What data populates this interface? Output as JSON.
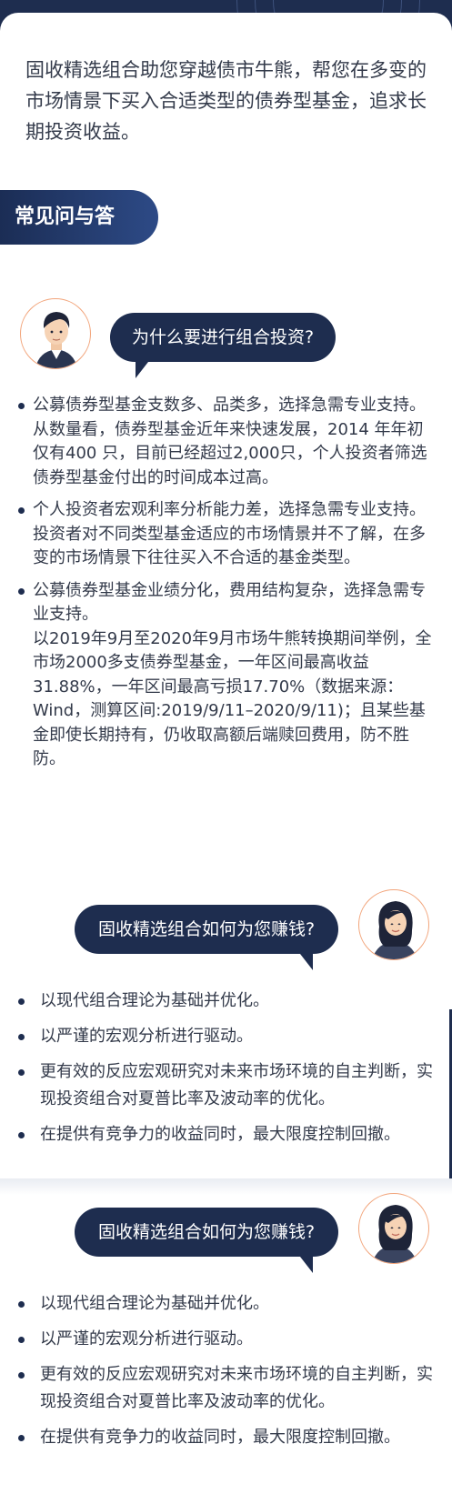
{
  "intro": {
    "text": "固收精选组合助您穿越债市牛熊，帮您在多变的市场情景下买入合适类型的债券型基金，追求长期投资收益。"
  },
  "faq": {
    "title": "常见问与答"
  },
  "q1": {
    "question": "为什么要进行组合投资?",
    "avatar": "man-avatar",
    "answers": [
      {
        "head": "公募债券型基金支数多、品类多，选择急需专业支持。",
        "detail": "从数量看，债券型基金近年来快速发展，2014 年年初仅有400 只，目前已经超过2,000只，个人投资者筛选债券型基金付出的时间成本过高。"
      },
      {
        "head": "个人投资者宏观利率分析能力差，选择急需专业支持。",
        "detail": "投资者对不同类型基金适应的市场情景并不了解，在多变的市场情景下往往买入不合适的基金类型。"
      },
      {
        "head": "公募债券型基金业绩分化，费用结构复杂，选择急需专业支持。",
        "detail": "以2019年9月至2020年9月市场牛熊转换期间举例，全市场2000多支债券型基金，一年区间最高收益31.88%，一年区间最高亏损17.70%（数据来源：Wind，测算区间:2019/9/11–2020/9/11)；且某些基金即使长期持有，仍收取高额后端赎回费用，防不胜防。"
      }
    ]
  },
  "q2": {
    "question": "固收精选组合如何为您赚钱?",
    "avatar": "woman-avatar",
    "points": [
      "以现代组合理论为基础并优化。",
      "以严谨的宏观分析进行驱动。",
      "更有效的反应宏观研究对未来市场环境的自主判断，实现投资组合对夏普比率及波动率的优化。",
      "在提供有竞争力的收益同时，最大限度控制回撤。"
    ]
  },
  "q3": {
    "question": "固收精选组合如何为您赚钱?",
    "avatar": "woman-avatar",
    "points": [
      "以现代组合理论为基础并优化。",
      "以严谨的宏观分析进行驱动。",
      "更有效的反应宏观研究对未来市场环境的自主判断，实现投资组合对夏普比率及波动率的优化。",
      "在提供有竞争力的收益同时，最大限度控制回撤。"
    ]
  },
  "colors": {
    "navy": "#1e2d4f",
    "text": "#333a4a",
    "avatar_ring": "#f2a47a"
  }
}
